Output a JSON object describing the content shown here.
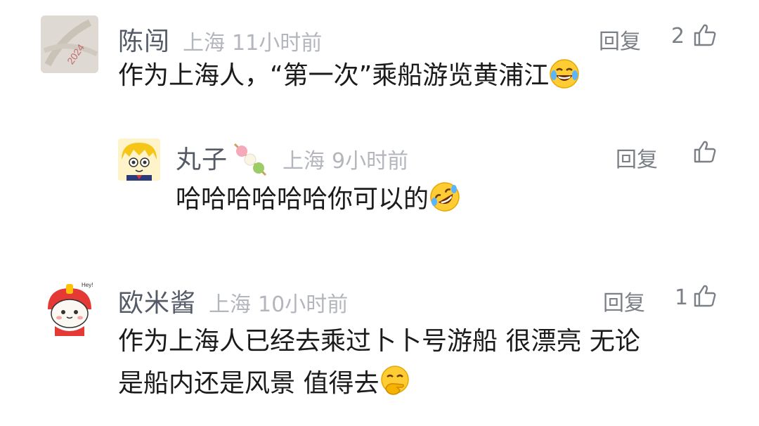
{
  "comments": [
    {
      "author": "陈闯",
      "location": "上海",
      "time": "11小时前",
      "reply_label": "回复",
      "likes": "2",
      "text": "作为上海人，“第一次”乘船游览黄浦江",
      "emoji": "laughing-tears"
    },
    {
      "author": "丸子",
      "location": "上海",
      "time": "9小时前",
      "reply_label": "回复",
      "likes": "",
      "text": "哈哈哈哈哈哈你可以的",
      "emoji": "rofl",
      "is_reply": true
    },
    {
      "author": "欧米酱",
      "location": "上海",
      "time": "10小时前",
      "reply_label": "回复",
      "likes": "1",
      "text_line1": "作为上海人已经去乘过卜卜号游船 很漂亮 无论",
      "text_line2": "是船内还是风景 值得去",
      "emoji": "thinking-hand-over-mouth"
    }
  ],
  "colors": {
    "author": "#555b66",
    "meta": "#b3b6bc",
    "text": "#1b1b1b",
    "action": "#7b7f86"
  }
}
